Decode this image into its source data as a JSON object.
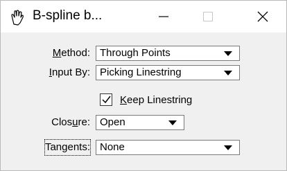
{
  "window": {
    "title": "B-spline b...",
    "controls": {
      "minimize_icon": "minimize-icon",
      "maximize_icon": "maximize-icon",
      "close_icon": "close-icon"
    }
  },
  "form": {
    "method": {
      "label_pre": "",
      "label_key": "M",
      "label_post": "ethod:",
      "value": "Through Points"
    },
    "input_by": {
      "label_pre": "",
      "label_key": "I",
      "label_post": "nput By:",
      "value": "Picking Linestring"
    },
    "keep_linestring": {
      "label_pre": "",
      "label_key": "K",
      "label_post": "eep Linestring",
      "checked": true
    },
    "closure": {
      "label_pre": "Clos",
      "label_key": "u",
      "label_post": "re:",
      "value": "Open"
    },
    "tangents": {
      "label": "Tangents:",
      "value": "None"
    }
  }
}
